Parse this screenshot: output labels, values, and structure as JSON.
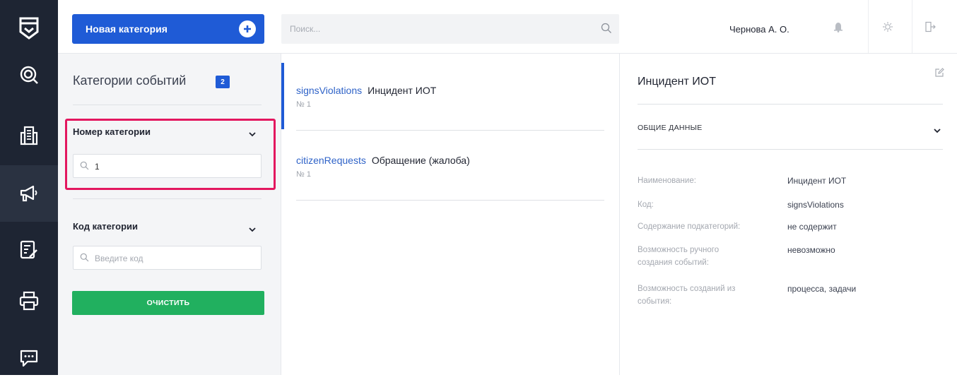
{
  "topbar": {
    "new_category_label": "Новая категория",
    "search_placeholder": "Поиск...",
    "user_name": "Чернова А. О."
  },
  "filters": {
    "title": "Категории событий",
    "count": "2",
    "category_number": {
      "label": "Номер категории",
      "value": "1"
    },
    "category_code": {
      "label": "Код категории",
      "placeholder": "Введите код"
    },
    "clear_label": "ОЧИСТИТЬ"
  },
  "list": {
    "items": [
      {
        "code": "signsViolations",
        "name": "Инцидент ИОТ",
        "number": "№ 1"
      },
      {
        "code": "citizenRequests",
        "name": "Обращение (жалоба)",
        "number": "№ 1"
      }
    ]
  },
  "detail": {
    "title": "Инцидент ИОТ",
    "section_label": "ОБЩИЕ ДАННЫЕ",
    "fields": [
      {
        "label": "Наименование:",
        "value": "Инцидент ИОТ"
      },
      {
        "label": "Код:",
        "value": "signsViolations"
      },
      {
        "label": "Содержание подкатегорий:",
        "value": "не содержит"
      },
      {
        "label": "Возможность ручного создания событий:",
        "value": "невозможно"
      },
      {
        "label": "Возможность созданий из события:",
        "value": "процесса, задачи"
      }
    ]
  },
  "colors": {
    "rail_bg": "#1e2533",
    "primary": "#1f5bd6",
    "success": "#21b05f",
    "highlight": "#e3175f"
  },
  "icons": [
    "app-logo-icon",
    "radar-icon",
    "building-icon",
    "megaphone-icon",
    "checklist-icon",
    "printer-icon",
    "chat-icon",
    "plus-icon",
    "search-icon",
    "bell-icon",
    "gear-icon",
    "logout-icon",
    "chevron-down-icon",
    "edit-icon"
  ]
}
